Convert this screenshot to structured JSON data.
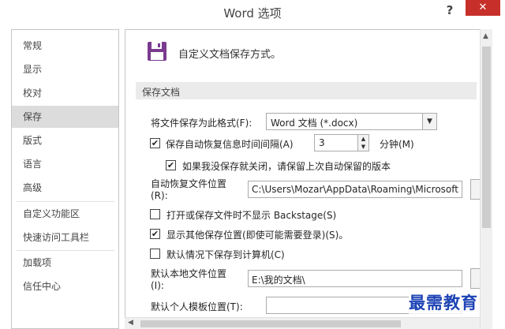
{
  "window": {
    "title": "Word 选项",
    "help_glyph": "?",
    "close_glyph": "✕"
  },
  "sidebar": {
    "items": [
      {
        "label": "常规"
      },
      {
        "label": "显示"
      },
      {
        "label": "校对"
      },
      {
        "label": "保存"
      },
      {
        "label": "版式"
      },
      {
        "label": "语言"
      },
      {
        "label": "高级"
      },
      {
        "label": "自定义功能区"
      },
      {
        "label": "快速访问工具栏"
      },
      {
        "label": "加载项"
      },
      {
        "label": "信任中心"
      }
    ],
    "selected_label": "保存"
  },
  "content": {
    "header_text": "自定义文档保存方式。",
    "group_title": "保存文档",
    "save_format_label": "将文件保存为此格式(F):",
    "save_format_value": "Word 文档 (*.docx)",
    "autorecover_label": "保存自动恢复信息时间间隔(A)",
    "autorecover_checked": true,
    "autorecover_minutes": "3",
    "minutes_label": "分钟(M)",
    "keep_last_label": "如果我没保存就关闭，请保留上次自动保留的版本",
    "keep_last_checked": true,
    "autorecover_location_label_1": "自动恢复文件位置",
    "autorecover_location_label_2": "(R):",
    "autorecover_location_value": "C:\\Users\\Mozar\\AppData\\Roaming\\Microsoft",
    "no_backstage_label": "打开或保存文件时不显示 Backstage(S)",
    "no_backstage_checked": false,
    "show_other_label": "显示其他保存位置(即使可能需要登录)(S)。",
    "show_other_checked": true,
    "save_computer_label": "默认情况下保存到计算机(C)",
    "save_computer_checked": false,
    "local_location_label_1": "默认本地文件位置",
    "local_location_label_2": "(I):",
    "local_location_value": "E:\\我的文档\\",
    "template_location_label": "默认个人模板位置(T):",
    "template_location_value": ""
  },
  "watermark": "最需教育",
  "colors": {
    "close_button": "#c7302a",
    "selected_nav": "#dcdcdc",
    "icon_accent": "#7a3b8f",
    "watermark": "#1d43b5"
  }
}
